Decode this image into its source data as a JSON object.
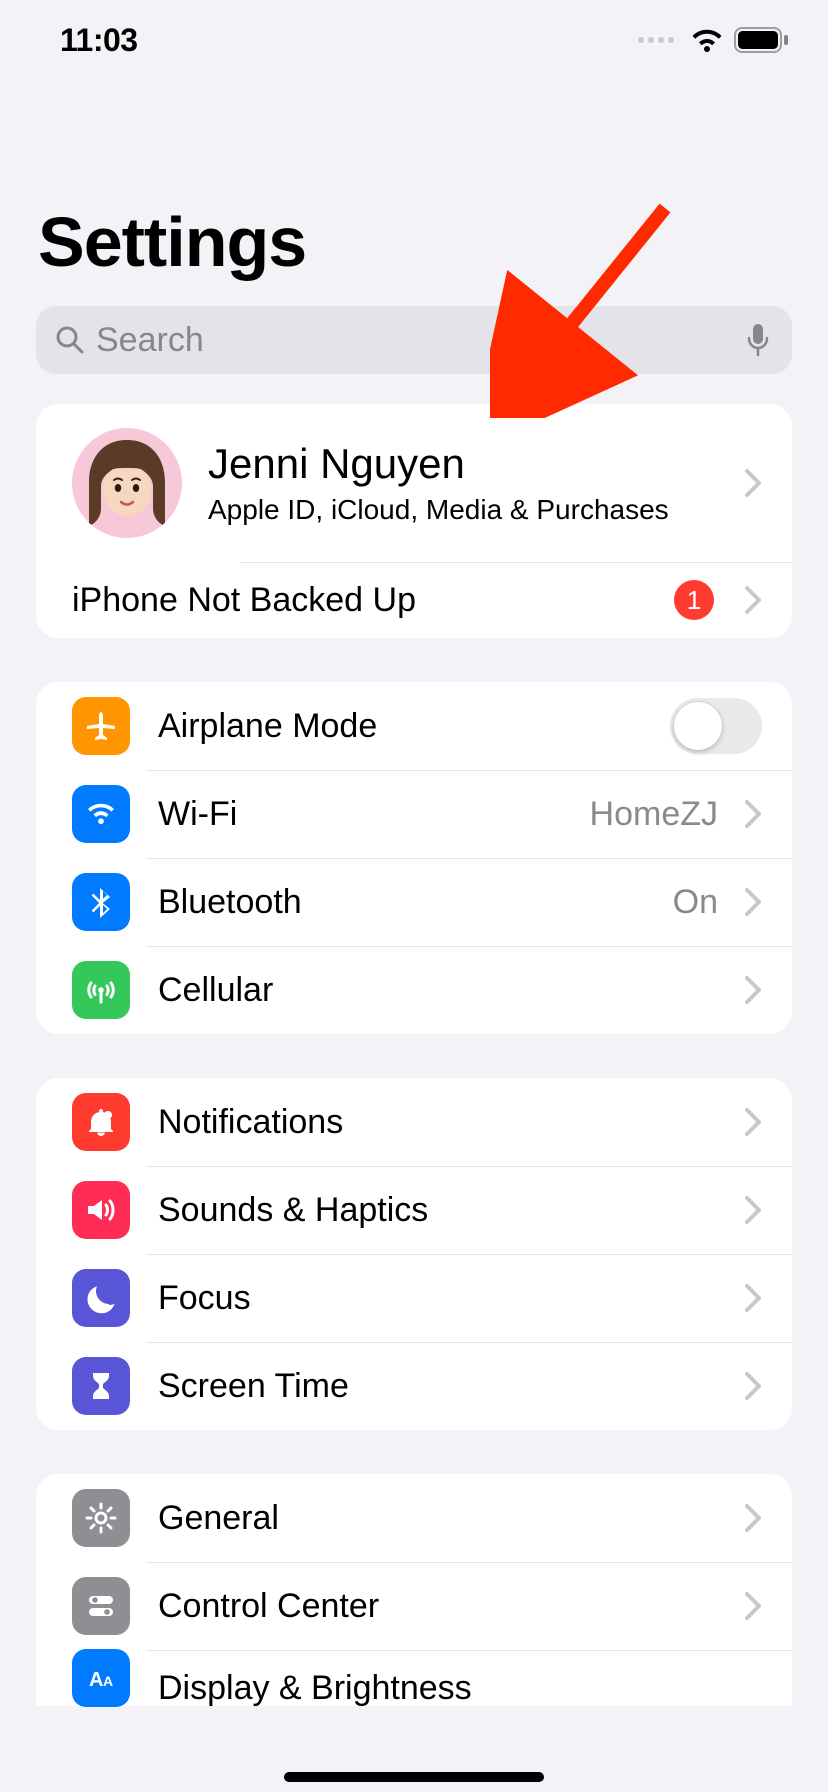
{
  "status": {
    "time": "11:03"
  },
  "title": "Settings",
  "search": {
    "placeholder": "Search"
  },
  "profile": {
    "name": "Jenni Nguyen",
    "subtitle": "Apple ID, iCloud, Media & Purchases"
  },
  "backup": {
    "label": "iPhone Not Backed Up",
    "badge": "1"
  },
  "group1": [
    {
      "label": "Airplane Mode",
      "value": "",
      "toggle": true
    },
    {
      "label": "Wi-Fi",
      "value": "HomeZJ",
      "chevron": true
    },
    {
      "label": "Bluetooth",
      "value": "On",
      "chevron": true
    },
    {
      "label": "Cellular",
      "value": "",
      "chevron": true
    }
  ],
  "group2": [
    {
      "label": "Notifications"
    },
    {
      "label": "Sounds & Haptics"
    },
    {
      "label": "Focus"
    },
    {
      "label": "Screen Time"
    }
  ],
  "group3": [
    {
      "label": "General"
    },
    {
      "label": "Control Center"
    },
    {
      "label": "Display & Brightness"
    }
  ],
  "colors": {
    "badge": "#ff3b30"
  }
}
